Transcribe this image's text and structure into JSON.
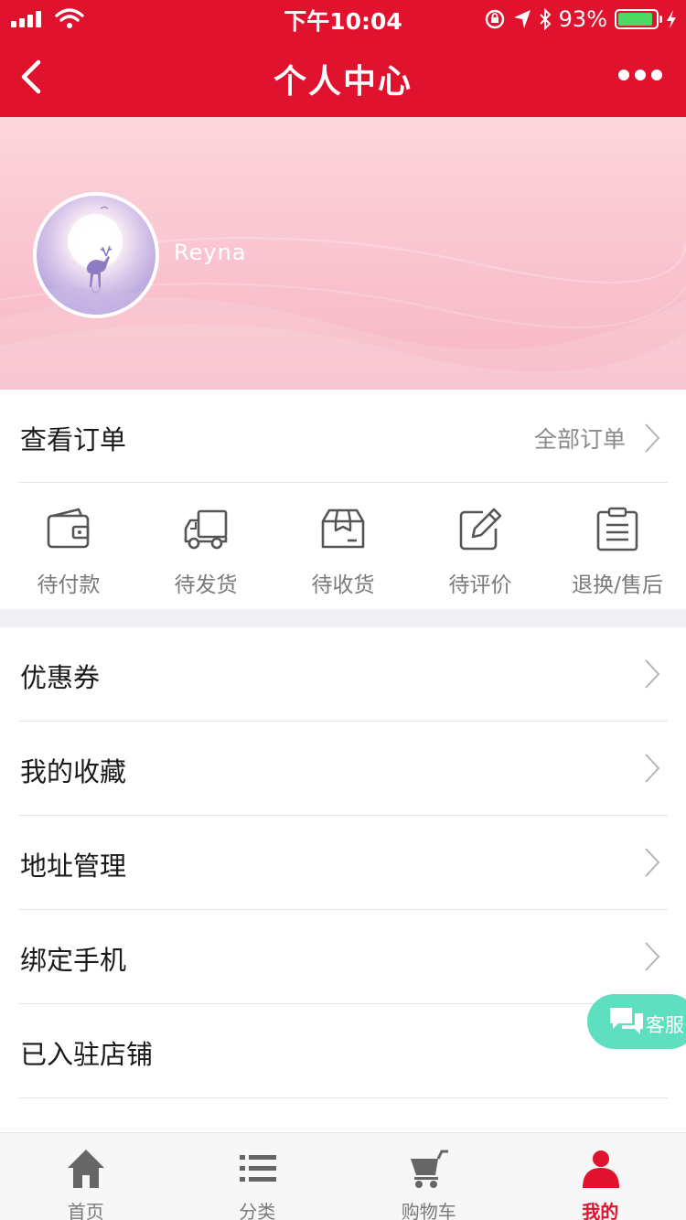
{
  "status_bar": {
    "time": "下午10:04",
    "battery": "93%",
    "battery_level": 0.93
  },
  "nav": {
    "title": "个人中心",
    "back_icon": "chevron-left-icon",
    "more_icon": "more-dots-icon"
  },
  "profile": {
    "username": "Reyna",
    "avatar_icon": "avatar-deer-moon"
  },
  "orders": {
    "title": "查看订单",
    "all_label": "全部订单",
    "items": [
      {
        "label": "待付款",
        "icon": "wallet-icon"
      },
      {
        "label": "待发货",
        "icon": "truck-icon"
      },
      {
        "label": "待收货",
        "icon": "package-box-icon"
      },
      {
        "label": "待评价",
        "icon": "edit-review-icon"
      },
      {
        "label": "退换/售后",
        "icon": "clipboard-list-icon"
      }
    ]
  },
  "menu": {
    "items": [
      {
        "label": "优惠券",
        "has_arrow": true
      },
      {
        "label": "我的收藏",
        "has_arrow": true
      },
      {
        "label": "地址管理",
        "has_arrow": true
      },
      {
        "label": "绑定手机",
        "has_arrow": true
      },
      {
        "label": "已入驻店铺",
        "has_arrow": false
      }
    ]
  },
  "customer_service": {
    "label": "客服",
    "icon": "chat-bubbles-icon",
    "color": "#5ddfc0"
  },
  "tabbar": {
    "active_index": 3,
    "items": [
      {
        "label": "首页",
        "icon": "home-icon"
      },
      {
        "label": "分类",
        "icon": "list-icon"
      },
      {
        "label": "购物车",
        "icon": "cart-icon"
      },
      {
        "label": "我的",
        "icon": "user-icon"
      }
    ]
  },
  "colors": {
    "brand": "#e0122e",
    "muted_text": "#7a7a7a",
    "banner_pink": "#f9c2ce"
  }
}
